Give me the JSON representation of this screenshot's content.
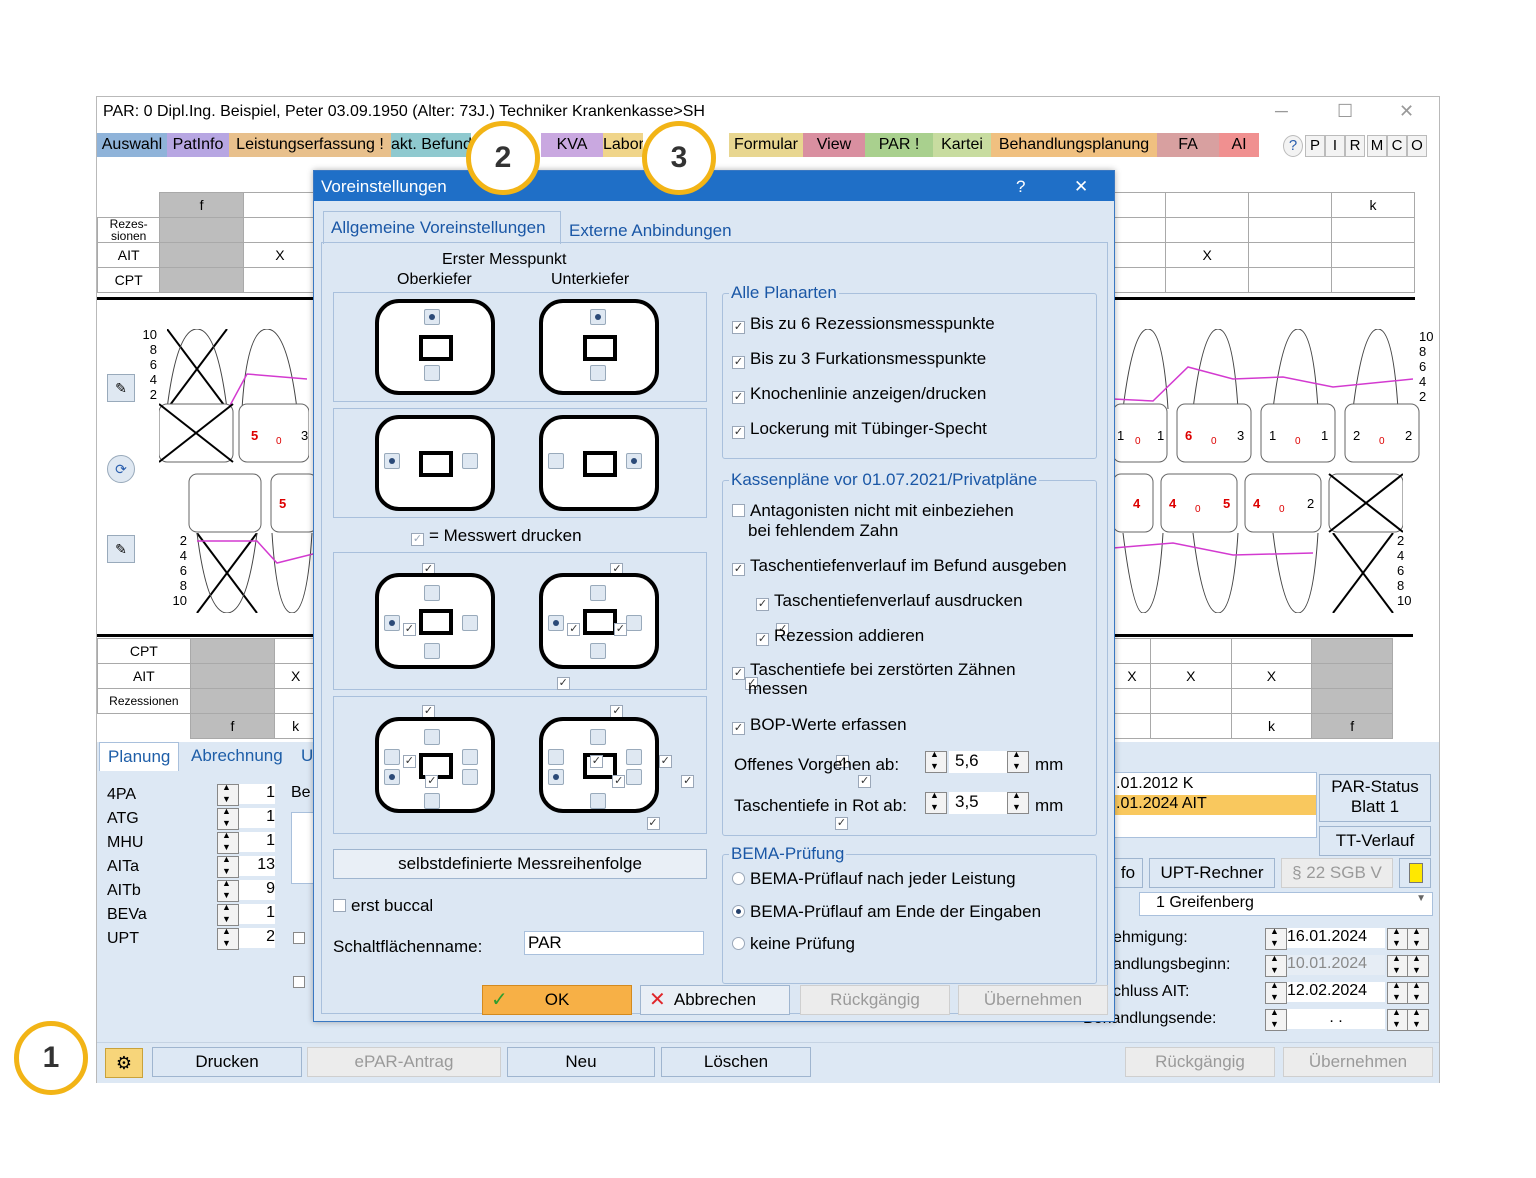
{
  "window": {
    "title": "PAR: 0  Dipl.Ing. Beispiel, Peter  03.09.1950 (Alter: 73J.)  Techniker Krankenkasse>SH",
    "minimize": "─",
    "maximize": "☐",
    "close": "✕"
  },
  "menu": {
    "tabs": [
      {
        "label": "Auswahl",
        "color": "#8fb3d9"
      },
      {
        "label": "PatInfo",
        "color": "#b7a6e2"
      },
      {
        "label": "Leistungserfassung !",
        "color": "#e8c08c"
      },
      {
        "label": "akt. Befund",
        "color": "#8fc9cf"
      },
      {
        "label": "KVA",
        "color": "#c9a8e0"
      },
      {
        "label": "Labor",
        "color": "#f0d58a"
      },
      {
        "label": "Formular",
        "color": "#e8d690"
      },
      {
        "label": "View",
        "color": "#d98fa0"
      },
      {
        "label": "PAR !",
        "color": "#a9d08e"
      },
      {
        "label": "Kartei",
        "color": "#c8dca0"
      },
      {
        "label": "Behandlungsplanung",
        "color": "#f0c080"
      },
      {
        "label": "FA",
        "color": "#d8a0a0"
      },
      {
        "label": "AI",
        "color": "#f09090"
      }
    ],
    "right_buttons": [
      "P",
      "I",
      "R",
      "M",
      "C",
      "O"
    ]
  },
  "chart": {
    "top_left_letter": "f",
    "top_right_letter": "k",
    "rows_top": [
      "Rezes-sionen",
      "AIT",
      "CPT"
    ],
    "x_mark": "X",
    "scale_left_top": [
      "10",
      "8",
      "6",
      "4",
      "2"
    ],
    "scale_left_bottom": [
      "2",
      "4",
      "6",
      "8",
      "10"
    ],
    "scale_right_top": [
      "10",
      "8",
      "6",
      "4",
      "2"
    ],
    "scale_right_bottom": [
      "2",
      "4",
      "6",
      "8",
      "10"
    ],
    "rows_bottom": [
      "CPT",
      "AIT",
      "Rezessionen"
    ],
    "bottom_left_letters": [
      "f",
      "k"
    ],
    "bottom_right_letters": [
      "k",
      "f"
    ],
    "bottom_right_x": [
      "X",
      "X",
      "X"
    ]
  },
  "lower": {
    "tabs": [
      "Planung",
      "Abrechnung",
      "U"
    ],
    "counts": [
      {
        "label": "4PA",
        "value": "1"
      },
      {
        "label": "ATG",
        "value": "1"
      },
      {
        "label": "MHU",
        "value": "1"
      },
      {
        "label": "AITa",
        "value": "13"
      },
      {
        "label": "AITb",
        "value": "9"
      },
      {
        "label": "BEVa",
        "value": "1"
      },
      {
        "label": "UPT",
        "value": "2"
      }
    ],
    "be_label": "Be",
    "history": [
      ".01.2012  K",
      ".01.2024  AIT"
    ],
    "par_status": "PAR-Status Blatt 1",
    "tt_verlauf": "TT-Verlauf",
    "fo_btn": "fo",
    "upt_rechner": "UPT-Rechner",
    "sgb": "§ 22 SGB V",
    "location": "1 Greifenberg",
    "dates": [
      {
        "label": "ehmigung:",
        "value": "16.01.2024"
      },
      {
        "label": "andlungsbeginn:",
        "value": "10.01.2024"
      },
      {
        "label": "chluss AIT:",
        "value": "12.02.2024"
      },
      {
        "label": "Behandlungsende:",
        "value": " .  . "
      }
    ]
  },
  "bottombar": {
    "drucken": "Drucken",
    "epar": "ePAR-Antrag",
    "neu": "Neu",
    "loeschen": "Löschen",
    "rueck": "Rückgängig",
    "uebern": "Übernehmen"
  },
  "dialog": {
    "title": "Voreinstellungen",
    "help": "?",
    "close": "✕",
    "tab1": "Allgemeine Voreinstellungen",
    "tab2": "Externe Anbindungen",
    "erster_messpunkt": "Erster Messpunkt",
    "oberkiefer": "Oberkiefer",
    "unterkiefer": "Unterkiefer",
    "messwert_drucken": "= Messwert drucken",
    "selbstdefiniert": "selbstdefinierte Messreihenfolge",
    "erst_buccal": "erst buccal",
    "schaltflaechenname_label": "Schaltflächenname:",
    "schaltflaechenname_value": "PAR",
    "alle_planarten": {
      "title": "Alle Planarten",
      "items": [
        "Bis zu 6 Rezessionsmesspunkte",
        "Bis zu 3 Furkationsmesspunkte",
        "Knochenlinie anzeigen/drucken",
        "Lockerung mit Tübinger-Specht"
      ]
    },
    "kassenplaene": {
      "title": "Kassenpläne vor 01.07.2021/Privatpläne",
      "antagonisten_1": "Antagonisten nicht mit einbeziehen",
      "antagonisten_2": "bei fehlendem Zahn",
      "taschen_befund": "Taschentiefenverlauf im Befund ausgeben",
      "taschen_drucken": "Taschentiefenverlauf ausdrucken",
      "rezession_add": "Rezession addieren",
      "zerstoert_1": "Taschentiefe bei zerstörten Zähnen",
      "zerstoert_2": "messen",
      "bop": "BOP-Werte erfassen",
      "offenes_label": "Offenes Vorgehen ab:",
      "offenes_value": "5,6",
      "rot_label": "Taschentiefe in Rot ab:",
      "rot_value": "3,5",
      "unit": "mm"
    },
    "bema": {
      "title": "BEMA-Prüfung",
      "options": [
        "BEMA-Prüflauf nach jeder Leistung",
        "BEMA-Prüflauf am Ende der Eingaben",
        "keine Prüfung"
      ]
    },
    "buttons": {
      "ok": "OK",
      "abbrechen": "Abbrechen",
      "rueck": "Rückgängig",
      "uebern": "Übernehmen"
    }
  },
  "callouts": [
    "1",
    "2",
    "3"
  ]
}
